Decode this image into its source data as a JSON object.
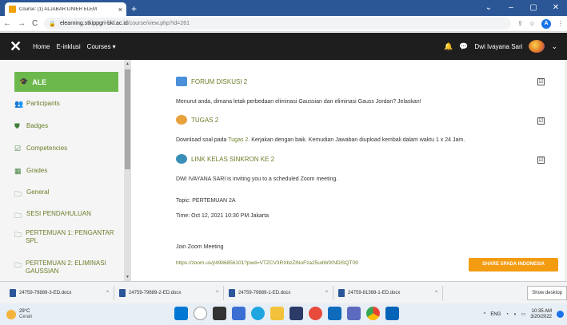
{
  "browser": {
    "tab_title": "Course: (1) ALJABAR LINIER ELEM",
    "tab_close": "×",
    "new_tab": "+",
    "url_host": "elearning.stkippgri-bkl.ac.id",
    "url_path": "/course/view.php?id=261",
    "back": "←",
    "forward": "→",
    "reload": "C",
    "lock": "🔒",
    "profile_letter": "A",
    "window_controls": [
      "⌄",
      "–",
      "▢",
      "✕"
    ]
  },
  "navbar": {
    "menu_icon": "hamburger-icon",
    "home": "Home",
    "einklusi": "E-inklusi",
    "courses": "Courses ▾",
    "user_name": "Dwi Ivayana Sari",
    "user_chevron": "⌄"
  },
  "sidebar": {
    "header": "ALE",
    "items": [
      {
        "label": "Participants",
        "icon": "users-icon"
      },
      {
        "label": "Badges",
        "icon": "shield-icon"
      },
      {
        "label": "Competencies",
        "icon": "check-square-icon"
      },
      {
        "label": "Grades",
        "icon": "table-icon"
      },
      {
        "label": "General",
        "icon": "folder-icon"
      },
      {
        "label": "SESI PENDAHULUAN",
        "icon": "folder-icon"
      },
      {
        "label": "PERTEMUAN 1: PENGANTAR SPL",
        "icon": "folder-icon"
      },
      {
        "label": "PERTEMUAN 2: ELIMINASI GAUSSIAN",
        "icon": "folder-icon"
      }
    ]
  },
  "main": {
    "forum_title": "FORUM DISKUSI 2",
    "forum_question": "Menurut anda, dimana letak perbedaan eliminasi Gaussian dan eliminasi Gauss Jordan? Jelaskan!",
    "tugas_title": "TUGAS 2",
    "tugas_text_before": "Download soal pada ",
    "tugas_link": "Tugas 2",
    "tugas_text_after": ". Kerjakan dengan baik. Kemudian Jawaban diupload kembali dalam waktu 1 x 24 Jam.",
    "zoom_title": "LINK KELAS SINKRON KE 2",
    "zoom_invite": "DWI IVAYANA SARI is inviting you to a scheduled Zoom meeting.",
    "topic": "Topic: PERTEMUAN 2A",
    "time": "Time: Oct 12, 2021 10:30 PM Jakarta",
    "join": "Join Zoom Meeting",
    "zoom_link": "https://zoom.us/j/4986856101?pwd=VTZCV3RXbzZlNoFza25udWlXNDlSQT09",
    "share_button": "SHARE SPADA INDONESIA",
    "checkbox_mark": "☑"
  },
  "downloads": {
    "items": [
      "24759-79889-3-ED.docx",
      "24759-79889-2-ED.docx",
      "24759-79889-1-ED.docx",
      "24759-81368-1-ED.docx"
    ],
    "chevron": "^",
    "show_all": "Show desktop"
  },
  "taskbar": {
    "temperature": "29°C",
    "weather_desc": "Cerah",
    "lang": "ENG",
    "time": "10:35 AM",
    "date": "3/20/2022"
  },
  "colors": {
    "moodle_green": "#6cb84d",
    "link_green": "#6a7f2a",
    "share_orange": "#f39c12",
    "navbar": "#1e1e1e",
    "chrome_blue": "#2b5797"
  }
}
